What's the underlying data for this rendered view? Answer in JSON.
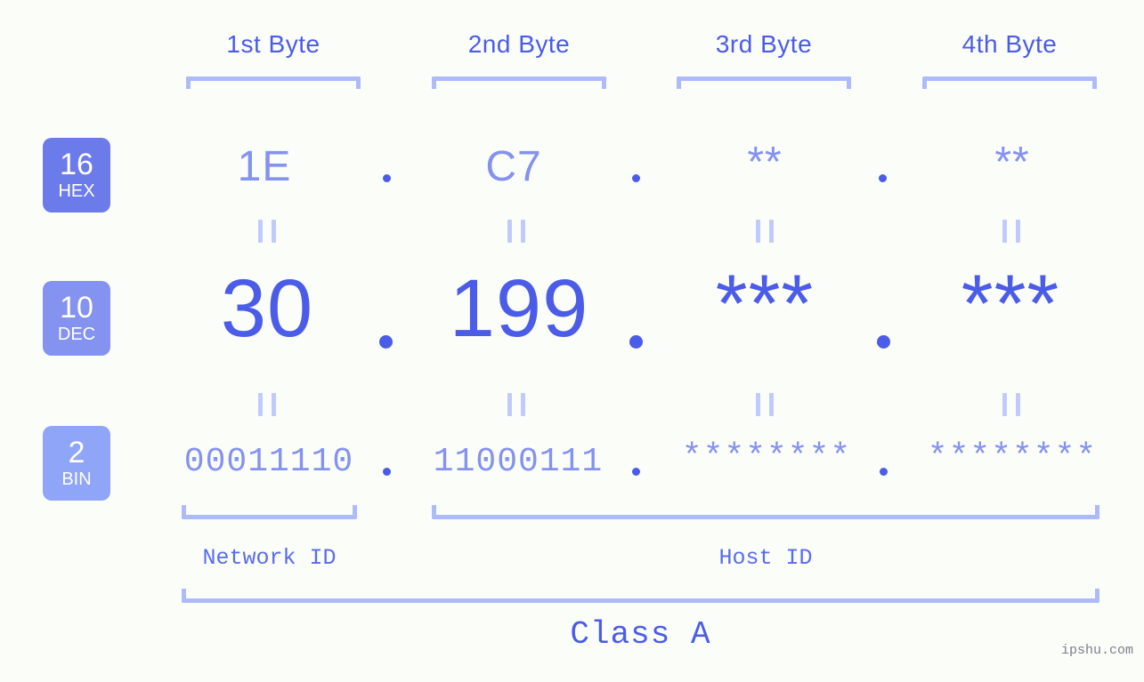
{
  "page": {
    "background_color": "#fbfdf8",
    "accent_color": "#4a5ce8",
    "accent_light_color": "#8492f0",
    "bracket_color": "#aebbfb"
  },
  "columns": [
    {
      "label": "1st Byte"
    },
    {
      "label": "2nd Byte"
    },
    {
      "label": "3rd Byte"
    },
    {
      "label": "4th Byte"
    }
  ],
  "rows": [
    {
      "badge": {
        "number": "16",
        "name": "HEX",
        "color": "#6c7bea"
      },
      "values": [
        "1E",
        "C7",
        "**",
        "**"
      ],
      "separator": "."
    },
    {
      "badge": {
        "number": "10",
        "name": "DEC",
        "color": "#8492f0"
      },
      "values": [
        "30",
        "199",
        "***",
        "***"
      ],
      "separator": "."
    },
    {
      "badge": {
        "number": "2",
        "name": "BIN",
        "color": "#8fa5f8"
      },
      "values": [
        "00011110",
        "11000111",
        "********",
        "********"
      ],
      "separator": "."
    }
  ],
  "equals_symbol": "=",
  "segments": {
    "network_id": "Network ID",
    "host_id": "Host ID"
  },
  "class_label": "Class A",
  "watermark": "ipshu.com"
}
